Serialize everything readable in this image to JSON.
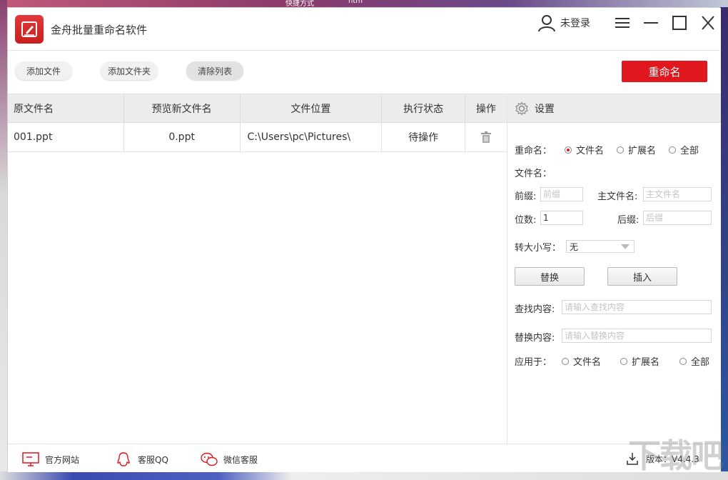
{
  "desktop": {
    "top_labels": [
      "快捷方式",
      "htm"
    ]
  },
  "window": {
    "title": "金舟批量重命名软件"
  },
  "user": {
    "label": "未登录"
  },
  "toolbar": {
    "add_file": "添加文件",
    "add_folder": "添加文件夹",
    "clear_list": "清除列表",
    "rename": "重命名"
  },
  "table": {
    "headers": [
      "原文件名",
      "预览新文件名",
      "文件位置",
      "执行状态",
      "操作"
    ],
    "rows": [
      {
        "original": "001.ppt",
        "preview": "0.ppt",
        "location": "C:\\Users\\pc\\Pictures\\",
        "status": "待操作"
      }
    ]
  },
  "settings": {
    "title": "设置",
    "rename_label": "重命名：",
    "rename_options": [
      "文件名",
      "扩展名",
      "全部"
    ],
    "rename_selected": "文件名",
    "filename_label": "文件名：",
    "prefix_label": "前缀:",
    "prefix_placeholder": "前缀",
    "main_label": "主文件名:",
    "main_placeholder": "主文件名",
    "digits_label": "位数:",
    "digits_value": "1",
    "suffix_label": "后缀:",
    "suffix_placeholder": "后缀",
    "case_label": "转大小写：",
    "case_value": "无",
    "replace_btn": "替换",
    "insert_btn": "插入",
    "find_label": "查找内容:",
    "find_placeholder": "请输入查找内容",
    "replace_label": "替换内容:",
    "replace_placeholder": "请输入替换内容",
    "apply_label": "应用于：",
    "apply_options": [
      "文件名",
      "扩展名",
      "全部"
    ]
  },
  "footer": {
    "website": "官方网站",
    "qq": "客服QQ",
    "wechat": "微信客服",
    "version": "版本：V4.4.3"
  },
  "watermark": "下载吧",
  "colors": {
    "accent": "#e0181e"
  }
}
